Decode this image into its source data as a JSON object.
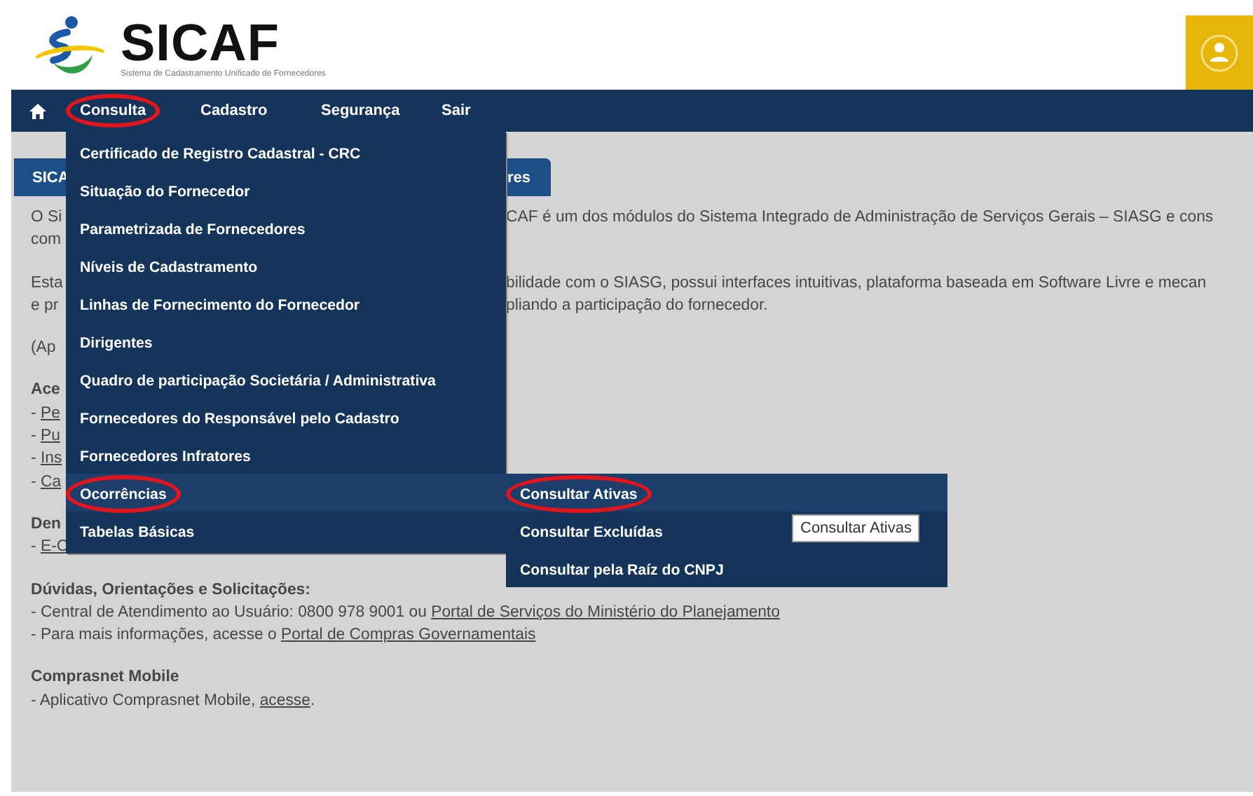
{
  "header": {
    "logo_title": "SICAF",
    "logo_subtitle": "Sistema de Cadastramento Unificado de Fornecedores"
  },
  "nav": [
    {
      "label": "Consulta",
      "circled": true
    },
    {
      "label": "Cadastro",
      "circled": false
    },
    {
      "label": "Segurança",
      "circled": false
    },
    {
      "label": "Sair",
      "circled": false
    }
  ],
  "menu": {
    "items": [
      {
        "label": "Certificado de Registro Cadastral - CRC",
        "selected": false,
        "circled": false
      },
      {
        "label": "Situação do Fornecedor",
        "selected": false,
        "circled": false
      },
      {
        "label": "Parametrizada de Fornecedores",
        "selected": false,
        "circled": false
      },
      {
        "label": "Níveis de Cadastramento",
        "selected": false,
        "circled": false
      },
      {
        "label": "Linhas de Fornecimento do Fornecedor",
        "selected": false,
        "circled": false
      },
      {
        "label": "Dirigentes",
        "selected": false,
        "circled": false
      },
      {
        "label": "Quadro de participação Societária / Administrativa",
        "selected": false,
        "circled": false
      },
      {
        "label": "Fornecedores do Responsável pelo Cadastro",
        "selected": false,
        "circled": false
      },
      {
        "label": "Fornecedores Infratores",
        "selected": false,
        "circled": false
      },
      {
        "label": "Ocorrências",
        "selected": true,
        "circled": true
      },
      {
        "label": "Tabelas Básicas",
        "selected": false,
        "circled": false
      }
    ],
    "submenu": [
      {
        "label": "Consultar Ativas",
        "selected": true,
        "circled": true
      },
      {
        "label": "Consultar Excluídas",
        "selected": false,
        "circled": false
      },
      {
        "label": "Consultar pela Raíz do CNPJ",
        "selected": false,
        "circled": false
      }
    ],
    "tooltip": "Consultar Ativas"
  },
  "content": {
    "banner": {
      "left": "SICA",
      "right": "res"
    },
    "paragraphs": [
      {
        "lines": [
          {
            "kind": "text",
            "left": "O Si",
            "right": "CAF é um dos módulos do Sistema Integrado de Administração de Serviços Gerais – SIASG e cons"
          },
          {
            "kind": "text",
            "left": "com"
          }
        ]
      },
      {
        "lines": [
          {
            "kind": "text",
            "left": "Esta",
            "right": "bilidade com o SIASG, possui interfaces intuitivas, plataforma baseada em Software Livre e mecan"
          },
          {
            "kind": "text",
            "left": "e pr",
            "right": "pliando a participação do fornecedor."
          }
        ]
      },
      {
        "lines": [
          {
            "kind": "text",
            "left": "(Ap"
          }
        ]
      },
      {
        "lines": [
          {
            "kind": "heading",
            "left": "Ace"
          },
          {
            "kind": "link",
            "text": "- ",
            "link": "Pe"
          },
          {
            "kind": "link",
            "text": "- ",
            "link": "Pu"
          },
          {
            "kind": "link",
            "text": "- ",
            "link": "Ins"
          },
          {
            "kind": "link",
            "text": "- ",
            "link": "Ca"
          }
        ]
      },
      {
        "lines": [
          {
            "kind": "heading",
            "left": "Den"
          },
          {
            "kind": "link",
            "text": "- ",
            "link": "E-C"
          }
        ]
      },
      {
        "lines": [
          {
            "kind": "heading",
            "left": "Dúvidas, Orientações e Solicitações:"
          },
          {
            "kind": "link",
            "text": "- Central de Atendimento ao Usuário: 0800 978 9001 ou ",
            "link": "Portal de Serviços do Ministério do Planejamento"
          },
          {
            "kind": "link",
            "text": "- Para mais informações, acesse o ",
            "link": "Portal de Compras Governamentais"
          }
        ]
      },
      {
        "lines": [
          {
            "kind": "heading",
            "left": "Comprasnet Mobile"
          },
          {
            "kind": "link",
            "text": "- Aplicativo Comprasnet Mobile, ",
            "link": "acesse",
            "after": "."
          }
        ]
      }
    ]
  }
}
